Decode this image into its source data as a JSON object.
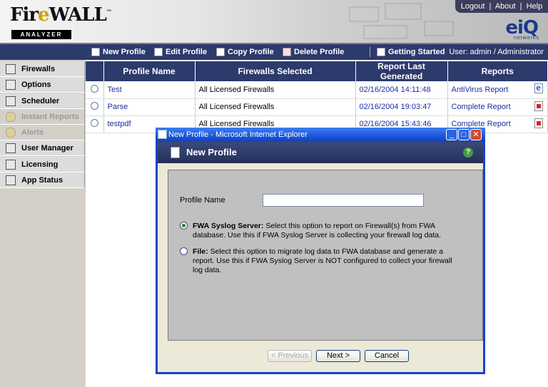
{
  "header": {
    "logo_text_main_1": "Fir",
    "logo_text_main_e": "e",
    "logo_text_main_2": "WALL",
    "logo_tm": "™",
    "logo_sub": "ANALYZER",
    "links": [
      "Logout",
      "About",
      "Help"
    ],
    "link_sep": "|",
    "brand": "eiQ",
    "brand_sub": "networks"
  },
  "toolbar": {
    "new_profile": "New Profile",
    "edit_profile": "Edit Profile",
    "copy_profile": "Copy Profile",
    "delete_profile": "Delete Profile",
    "getting_started": "Getting Started",
    "user": "User: admin / Administrator"
  },
  "sidebar": {
    "items": [
      {
        "label": "Firewalls",
        "disabled": false
      },
      {
        "label": "Options",
        "disabled": false
      },
      {
        "label": "Scheduler",
        "disabled": false
      },
      {
        "label": "Instant Reports",
        "disabled": true
      },
      {
        "label": "Alerts",
        "disabled": true
      },
      {
        "label": "User Manager",
        "disabled": false
      },
      {
        "label": "Licensing",
        "disabled": false
      },
      {
        "label": "App Status",
        "disabled": false
      }
    ]
  },
  "table": {
    "headers": [
      "Profile Name",
      "Firewalls Selected",
      "Report Last Generated",
      "Reports"
    ],
    "rows": [
      {
        "name": "Test",
        "firewalls": "All Licensed Firewalls",
        "generated": "02/16/2004 14:11:48",
        "report": "AntiVirus Report",
        "icon": "ie"
      },
      {
        "name": "Parse",
        "firewalls": "All Licensed Firewalls",
        "generated": "02/16/2004 19:03:47",
        "report": "Complete Report",
        "icon": "pdf"
      },
      {
        "name": "testpdf",
        "firewalls": "All Licensed Firewalls",
        "generated": "02/16/2004 15:43:46",
        "report": "Complete Report",
        "icon": "pdf"
      }
    ]
  },
  "modal": {
    "window_title": "New Profile - Microsoft Internet Explorer",
    "title": "New Profile",
    "help": "?",
    "profile_name_label": "Profile Name",
    "profile_name_value": "",
    "option1_bold": "FWA Syslog Server:",
    "option1_text": " Select this option to report on Firewall(s) from FWA database. Use this if FWA Syslog Server is collecting your firewall log data.",
    "option2_bold": "File:",
    "option2_text": " Select this option to migrate log data to FWA database and generate a report. Use this if FWA Syslog Server is NOT configured to collect your firewall log data.",
    "btn_previous": "< Previous",
    "btn_next": "Next >",
    "btn_cancel": "Cancel",
    "win_minimize": "_",
    "win_maximize": "□",
    "win_close": "✕"
  }
}
